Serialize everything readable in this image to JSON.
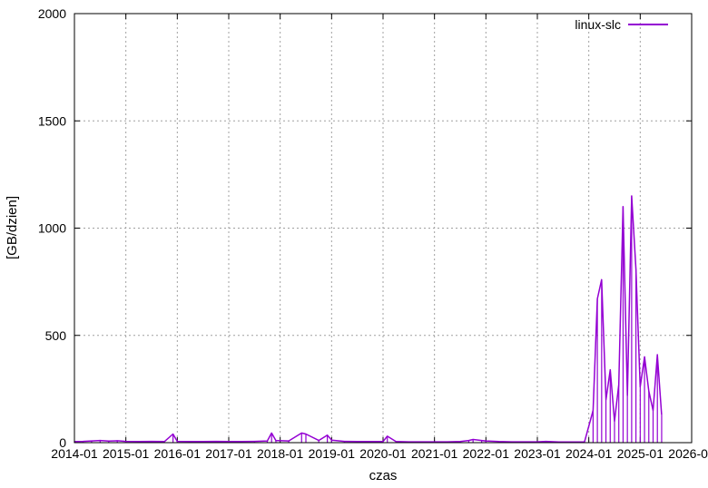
{
  "chart_data": {
    "type": "line",
    "xlabel": "czas",
    "ylabel": "[GB/dzien]",
    "ylim": [
      0,
      2000
    ],
    "xlim": [
      "2014-01",
      "2026-01"
    ],
    "grid": true,
    "legend_position": "top-right",
    "series_color": "#9400d3",
    "x_ticks": [
      "2014-01",
      "2015-01",
      "2016-01",
      "2017-01",
      "2018-01",
      "2019-01",
      "2020-01",
      "2021-01",
      "2022-01",
      "2023-01",
      "2024-01",
      "2025-01",
      "2026-01"
    ],
    "y_ticks": [
      0,
      500,
      1000,
      1500,
      2000
    ],
    "series": [
      {
        "name": "linux-slc",
        "points": [
          [
            "2014-01",
            5
          ],
          [
            "2014-03",
            6
          ],
          [
            "2014-05",
            8
          ],
          [
            "2014-07",
            10
          ],
          [
            "2014-09",
            7
          ],
          [
            "2014-11",
            9
          ],
          [
            "2015-01",
            6
          ],
          [
            "2015-04",
            5
          ],
          [
            "2015-07",
            6
          ],
          [
            "2015-10",
            5
          ],
          [
            "2015-12",
            40
          ],
          [
            "2016-01",
            6
          ],
          [
            "2016-04",
            5
          ],
          [
            "2016-07",
            5
          ],
          [
            "2016-10",
            6
          ],
          [
            "2017-01",
            5
          ],
          [
            "2017-04",
            5
          ],
          [
            "2017-07",
            6
          ],
          [
            "2017-10",
            8
          ],
          [
            "2017-11",
            45
          ],
          [
            "2017-12",
            10
          ],
          [
            "2018-03",
            8
          ],
          [
            "2018-06",
            45
          ],
          [
            "2018-07",
            40
          ],
          [
            "2018-10",
            10
          ],
          [
            "2018-12",
            35
          ],
          [
            "2019-01",
            12
          ],
          [
            "2019-04",
            6
          ],
          [
            "2019-07",
            5
          ],
          [
            "2019-10",
            5
          ],
          [
            "2020-01",
            5
          ],
          [
            "2020-02",
            30
          ],
          [
            "2020-04",
            5
          ],
          [
            "2020-07",
            4
          ],
          [
            "2020-10",
            4
          ],
          [
            "2021-01",
            4
          ],
          [
            "2021-04",
            4
          ],
          [
            "2021-07",
            5
          ],
          [
            "2021-09",
            10
          ],
          [
            "2021-10",
            15
          ],
          [
            "2021-12",
            10
          ],
          [
            "2022-01",
            8
          ],
          [
            "2022-04",
            5
          ],
          [
            "2022-07",
            4
          ],
          [
            "2022-10",
            4
          ],
          [
            "2023-01",
            4
          ],
          [
            "2023-03",
            6
          ],
          [
            "2023-06",
            3
          ],
          [
            "2023-09",
            3
          ],
          [
            "2023-12",
            3
          ],
          [
            "2024-02",
            150
          ],
          [
            "2024-03",
            670
          ],
          [
            "2024-04",
            760
          ],
          [
            "2024-05",
            200
          ],
          [
            "2024-06",
            340
          ],
          [
            "2024-07",
            100
          ],
          [
            "2024-08",
            270
          ],
          [
            "2024-09",
            1100
          ],
          [
            "2024-10",
            220
          ],
          [
            "2024-11",
            1150
          ],
          [
            "2024-12",
            810
          ],
          [
            "2025-01",
            260
          ],
          [
            "2025-02",
            400
          ],
          [
            "2025-03",
            240
          ],
          [
            "2025-04",
            150
          ],
          [
            "2025-05",
            410
          ],
          [
            "2025-06",
            130
          ]
        ]
      }
    ]
  }
}
